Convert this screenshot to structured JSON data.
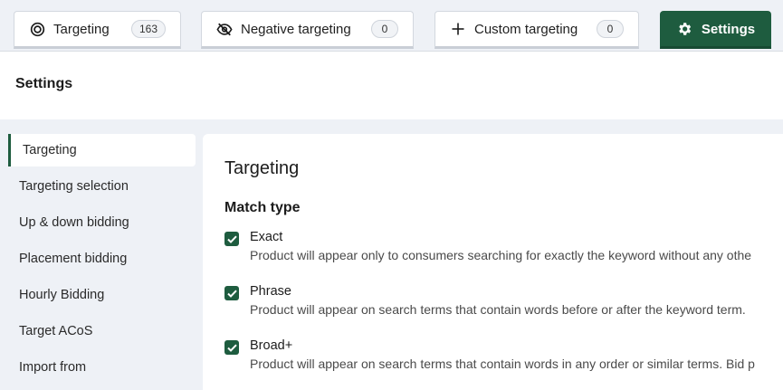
{
  "tabs": {
    "targeting": {
      "label": "Targeting",
      "count": "163"
    },
    "negative": {
      "label": "Negative targeting",
      "count": "0"
    },
    "custom": {
      "label": "Custom targeting",
      "count": "0"
    },
    "settings": {
      "label": "Settings"
    }
  },
  "header": {
    "title": "Settings"
  },
  "sidebar": {
    "items": [
      {
        "label": "Targeting",
        "active": true
      },
      {
        "label": "Targeting selection"
      },
      {
        "label": "Up & down bidding"
      },
      {
        "label": "Placement bidding"
      },
      {
        "label": "Hourly Bidding"
      },
      {
        "label": "Target ACoS"
      },
      {
        "label": "Import from"
      }
    ]
  },
  "content": {
    "title": "Targeting",
    "section_title": "Match type",
    "options": [
      {
        "label": "Exact",
        "checked": true,
        "description": "Product will appear only to consumers searching for exactly the keyword without any othe"
      },
      {
        "label": "Phrase",
        "checked": true,
        "description": "Product will appear on search terms that contain words before or after the keyword term."
      },
      {
        "label": "Broad+",
        "checked": true,
        "description": "Product will appear on search terms that contain words in any order or similar terms. Bid p"
      }
    ]
  },
  "colors": {
    "accent": "#1e5c3f",
    "background": "#eef1f6",
    "panel": "#ffffff"
  },
  "icons": {
    "targeting": "target-icon",
    "negative": "eye-slash-icon",
    "custom": "plus-icon",
    "settings": "gear-icon",
    "checkbox": "check-icon"
  }
}
